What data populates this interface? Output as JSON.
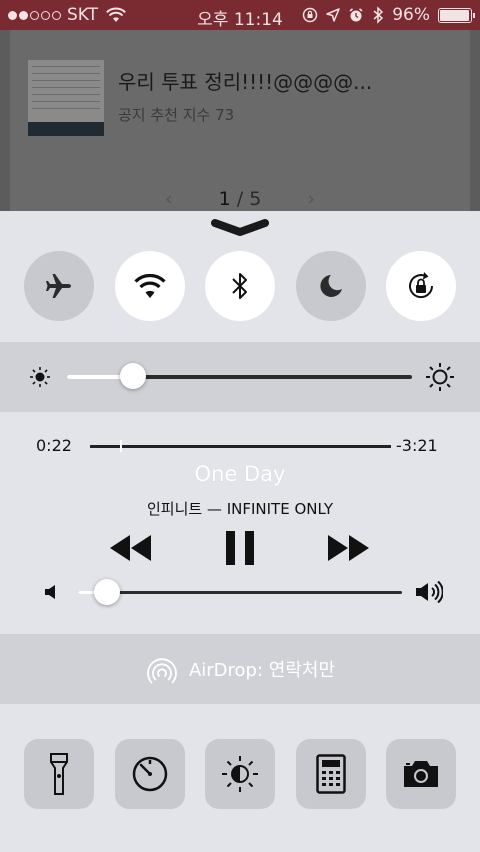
{
  "status_bar": {
    "carrier": "SKT",
    "time": "오후 11:14",
    "battery_percent": "96%",
    "battery_level": 0.96,
    "signal_bars_filled": 2,
    "signal_bars_total": 5,
    "background_color": "#7a2a31"
  },
  "background_app": {
    "post_title": "우리 투표 정리!!!!@@@@...",
    "post_meta": "공지 추천 지수 73",
    "pager_current": "1",
    "pager_separator": " / ",
    "pager_total": "5"
  },
  "control_center": {
    "toggles": [
      {
        "name": "airplane-mode",
        "icon": "airplane-icon",
        "active": false
      },
      {
        "name": "wifi",
        "icon": "wifi-icon",
        "active": true
      },
      {
        "name": "bluetooth",
        "icon": "bluetooth-icon",
        "active": true
      },
      {
        "name": "do-not-disturb",
        "icon": "moon-icon",
        "active": false
      },
      {
        "name": "rotation-lock",
        "icon": "rotation-lock-icon",
        "active": true
      }
    ],
    "brightness_level": 0.19,
    "music": {
      "elapsed": "0:22",
      "remaining": "-3:21",
      "progress": 0.1,
      "title": "One Day",
      "artist_album": "인피니트 — INFINITE ONLY",
      "volume_level": 0.09
    },
    "airdrop": {
      "label": "AirDrop: 연락처만",
      "icon": "airdrop-icon"
    },
    "shortcuts": [
      {
        "name": "flashlight",
        "icon": "flashlight-icon"
      },
      {
        "name": "timer",
        "icon": "timer-icon"
      },
      {
        "name": "night-shift",
        "icon": "night-shift-icon"
      },
      {
        "name": "calculator",
        "icon": "calculator-icon"
      },
      {
        "name": "camera",
        "icon": "camera-icon"
      }
    ]
  }
}
